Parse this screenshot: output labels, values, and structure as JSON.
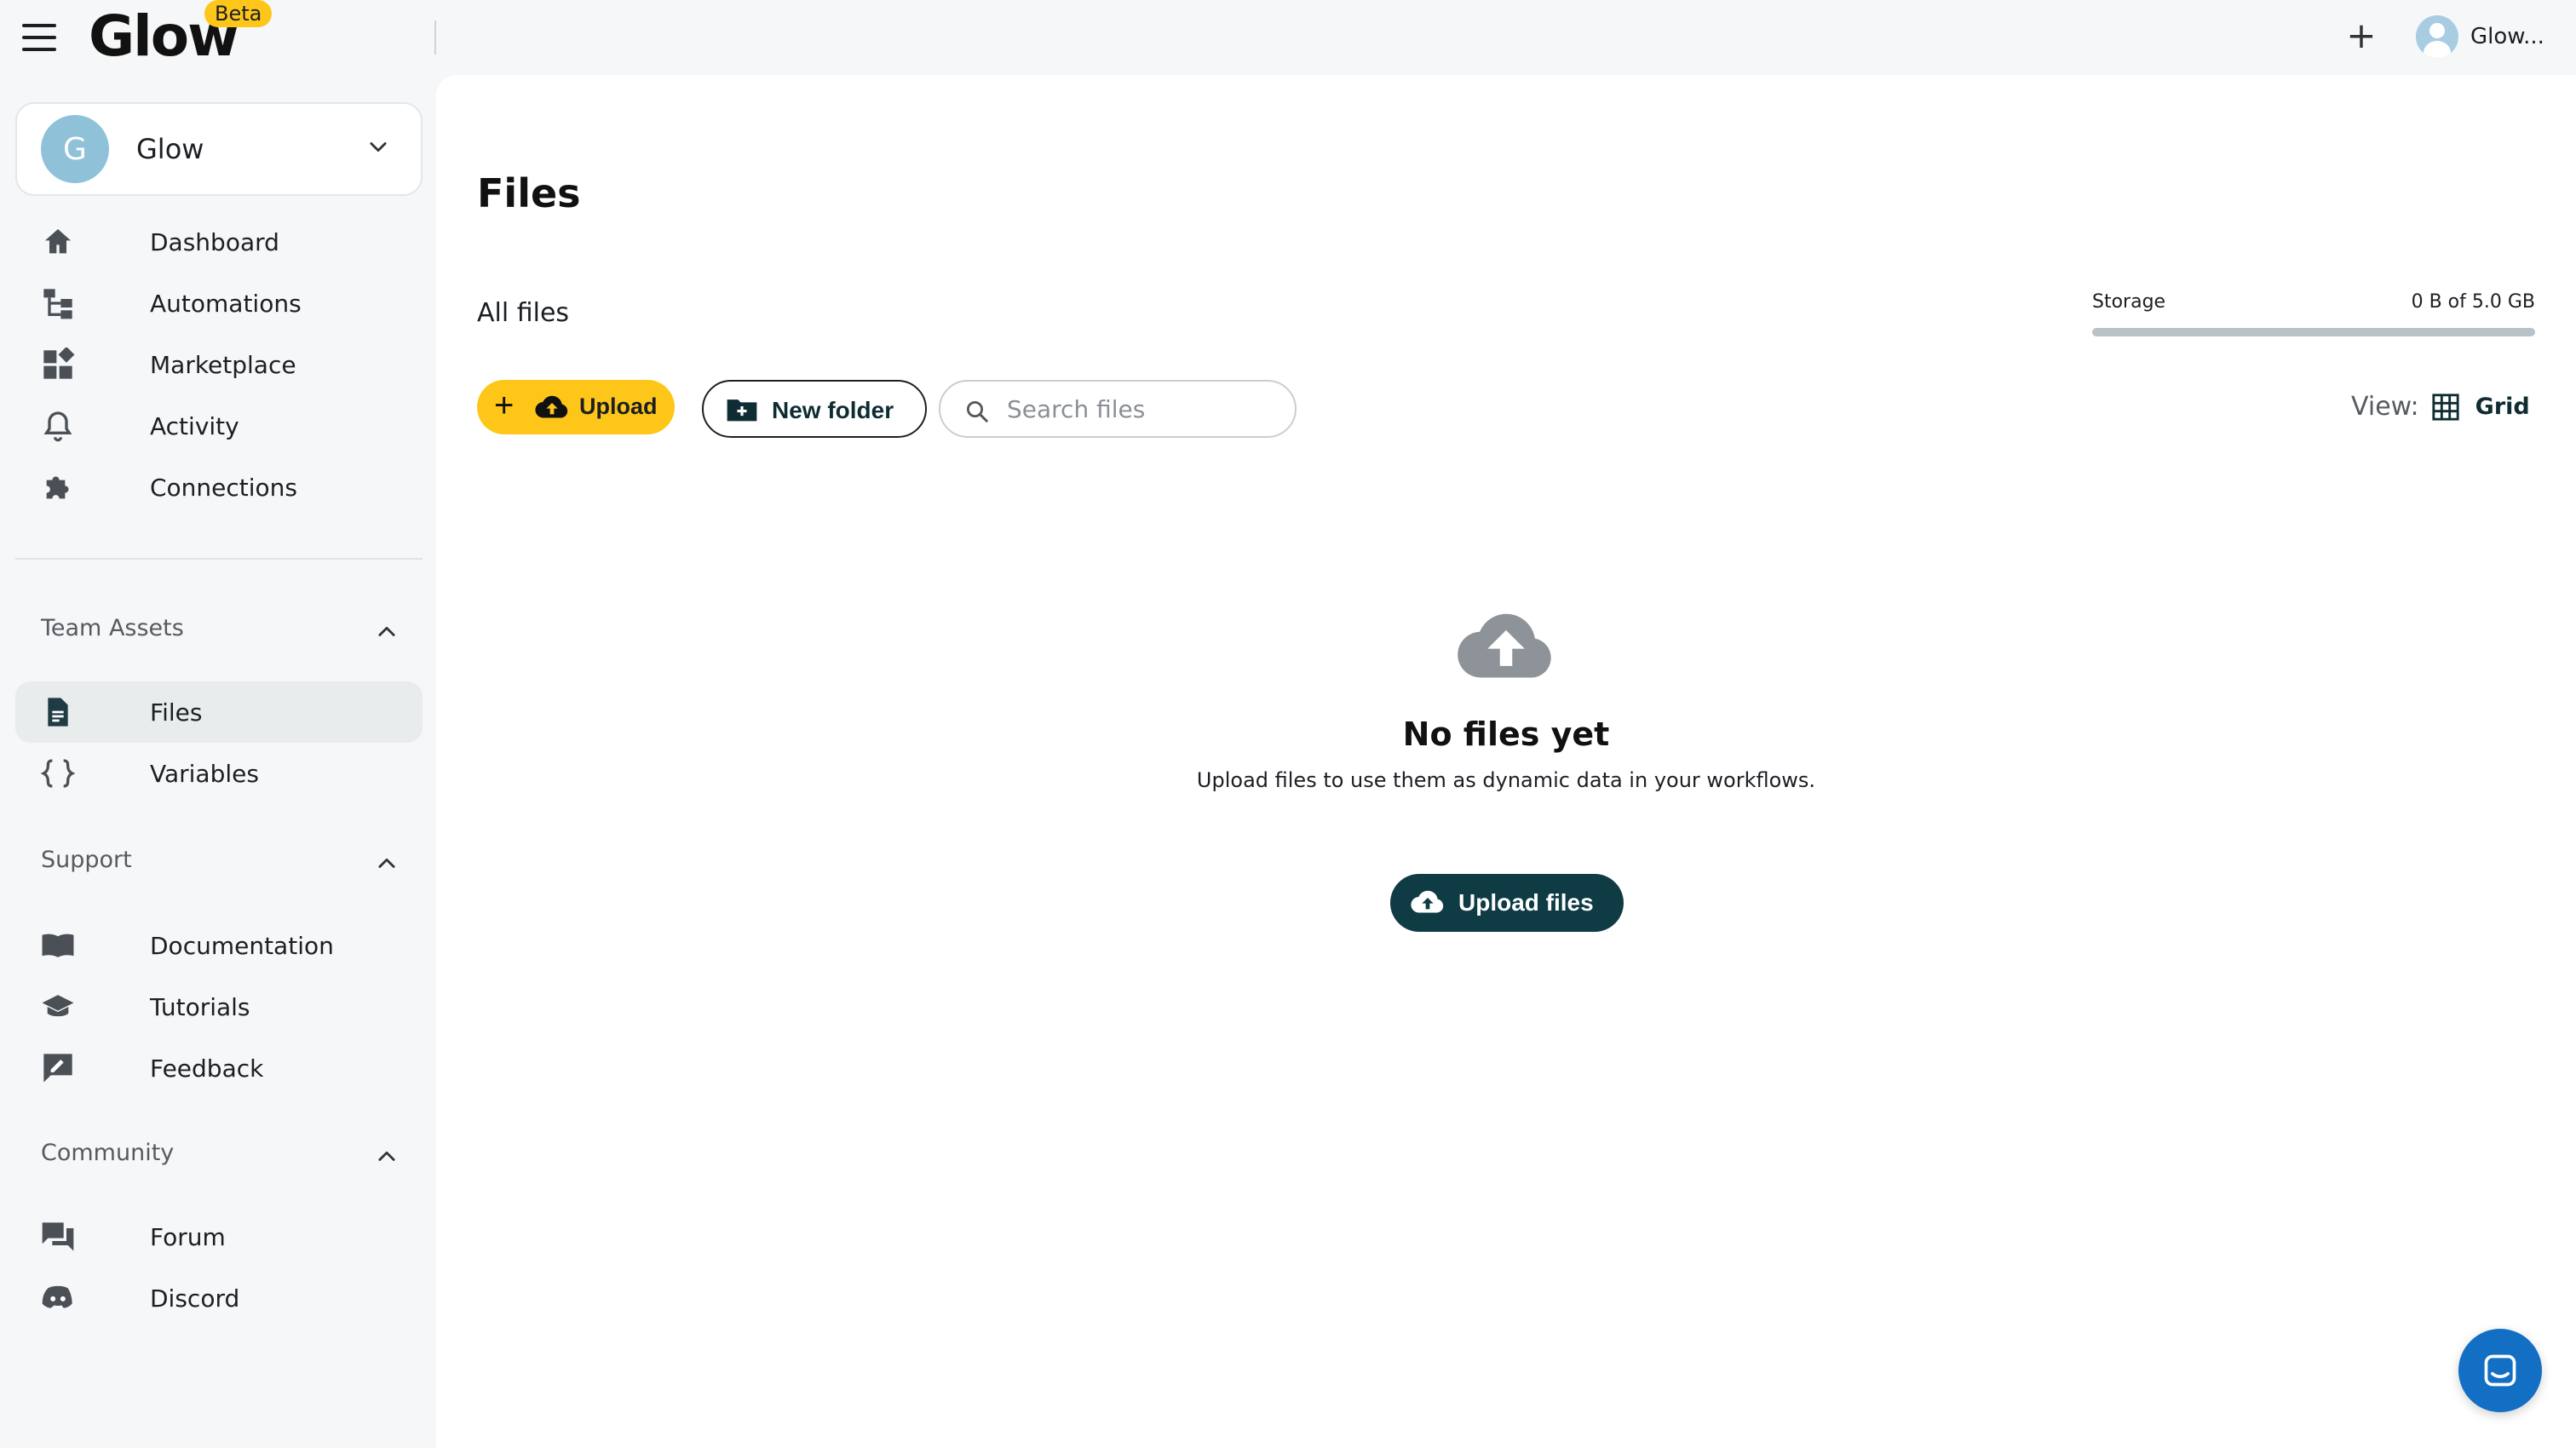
{
  "app": {
    "logo": "Glow",
    "badge": "Beta",
    "user_name": "Glow..."
  },
  "workspace": {
    "initial": "G",
    "name": "Glow"
  },
  "nav": {
    "main": [
      {
        "label": "Dashboard",
        "icon": "home-icon"
      },
      {
        "label": "Automations",
        "icon": "workflow-icon"
      },
      {
        "label": "Marketplace",
        "icon": "widgets-icon"
      },
      {
        "label": "Activity",
        "icon": "bell-icon"
      },
      {
        "label": "Connections",
        "icon": "puzzle-icon"
      }
    ],
    "team_assets": {
      "title": "Team Assets",
      "items": [
        {
          "label": "Files",
          "icon": "file-icon",
          "active": true
        },
        {
          "label": "Variables",
          "icon": "braces-icon"
        }
      ]
    },
    "support": {
      "title": "Support",
      "items": [
        {
          "label": "Documentation",
          "icon": "book-icon"
        },
        {
          "label": "Tutorials",
          "icon": "graduation-cap-icon"
        },
        {
          "label": "Feedback",
          "icon": "feedback-icon"
        }
      ]
    },
    "community": {
      "title": "Community",
      "items": [
        {
          "label": "Forum",
          "icon": "forum-icon"
        },
        {
          "label": "Discord",
          "icon": "discord-icon"
        }
      ]
    }
  },
  "page": {
    "title": "Files",
    "breadcrumb": "All files",
    "storage": {
      "label": "Storage",
      "value": "0 B of 5.0 GB",
      "used_fraction": 0
    },
    "toolbar": {
      "upload_label": "Upload",
      "new_folder_label": "New folder",
      "search_placeholder": "Search files",
      "search_value": "",
      "view_label": "View:",
      "view_value": "Grid"
    },
    "empty": {
      "heading": "No files yet",
      "text": "Upload files to use them as dynamic data in your workflows.",
      "button": "Upload files"
    }
  },
  "colors": {
    "accent_yellow": "#ffc61a",
    "primary_dark": "#0f3b44",
    "chat_blue": "#136fc4"
  }
}
